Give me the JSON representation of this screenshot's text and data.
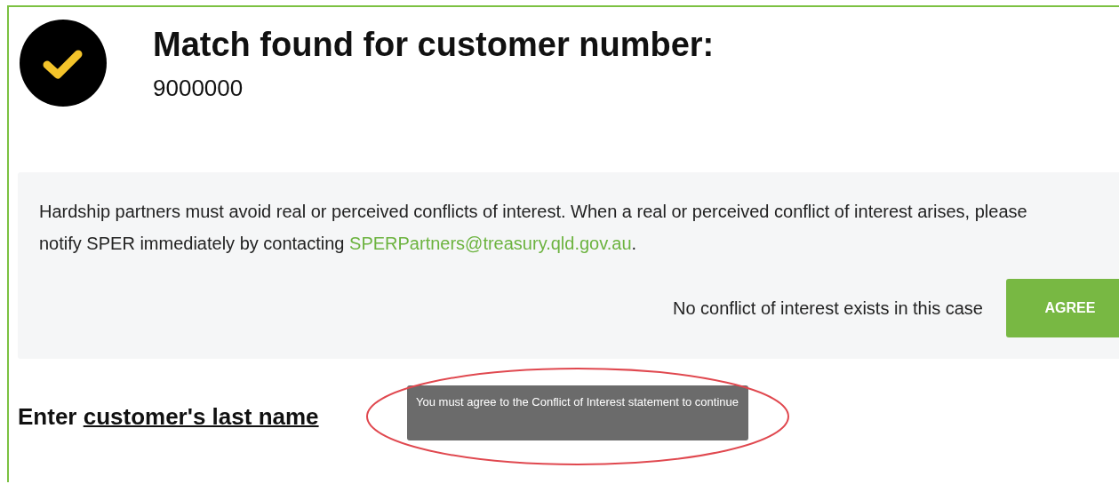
{
  "header": {
    "title": "Match found for customer number:",
    "customer_number": "9000000"
  },
  "notice": {
    "text_before": "Hardship partners must avoid real or perceived conflicts of interest. When a real or perceived conflict of interest arises, please notify SPER immediately by contacting ",
    "email": "SPERPartners@treasury.qld.gov.au",
    "text_after": "."
  },
  "agree_row": {
    "label": "No conflict of interest exists in this case",
    "button": "AGREE"
  },
  "prompt": {
    "lead": "Enter",
    "link": "customer's last name"
  },
  "tooltip": {
    "text": "You must agree to the Conflict of Interest statement to continue"
  }
}
